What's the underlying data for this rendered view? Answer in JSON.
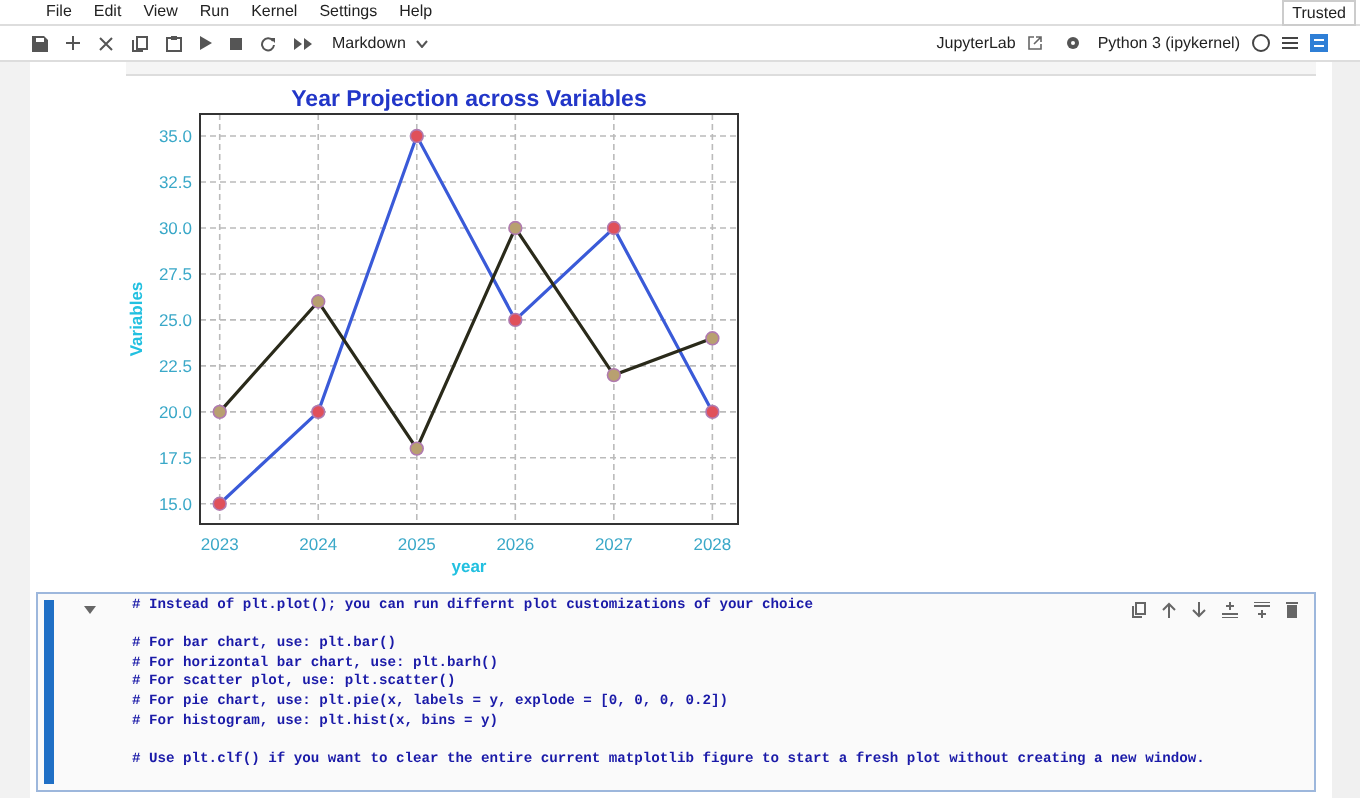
{
  "menu": [
    "File",
    "Edit",
    "View",
    "Run",
    "Kernel",
    "Settings",
    "Help"
  ],
  "trusted": "Trusted",
  "toolbar": {
    "cell_type": "Markdown",
    "jupyterlab": "JupyterLab",
    "kernel": "Python 3 (ipykernel)"
  },
  "output": {
    "chart_data": {
      "type": "line",
      "title": "Year Projection across Variables",
      "xlabel": "year",
      "ylabel": "Variables",
      "x": [
        2023,
        2024,
        2025,
        2026,
        2027,
        2028
      ],
      "series": [
        {
          "color": "#3a5ad8",
          "marker": "o",
          "values": [
            15,
            20,
            35,
            25,
            30,
            20
          ]
        },
        {
          "color": "#2a2a1a",
          "marker": "o",
          "values": [
            20,
            26,
            18,
            30,
            22,
            24
          ]
        }
      ],
      "grid": true,
      "xlim": [
        2022.8,
        2028.26
      ],
      "ylim": [
        13.9,
        36.2
      ],
      "xticks": [
        2023,
        2024,
        2025,
        2026,
        2027,
        2028
      ],
      "yticks": [
        {
          "value": 15,
          "label": "15.0"
        },
        {
          "value": 17.5,
          "label": "17.5"
        },
        {
          "value": 20,
          "label": "20.0"
        },
        {
          "value": 22.5,
          "label": "22.5"
        },
        {
          "value": 25,
          "label": "25.0"
        },
        {
          "value": 27.5,
          "label": "27.5"
        },
        {
          "value": 30,
          "label": "30.0"
        },
        {
          "value": 32.5,
          "label": "32.5"
        },
        {
          "value": 35,
          "label": "35.0"
        }
      ]
    }
  },
  "cell": {
    "blocks": [
      [
        "# Instead of plt.plot(); you can run differnt plot customizations of your choice"
      ],
      [
        "# For bar chart, use: plt.bar()",
        "# For horizontal bar chart, use: plt.barh()",
        "# For scatter plot, use: plt.scatter()",
        "# For pie chart, use: plt.pie(x, labels = y, explode = [0, 0, 0, 0.2])",
        "# For histogram, use: plt.hist(x, bins = y)"
      ],
      [
        "# Use plt.clf() if you want to clear the entire current matplotlib figure to start a fresh plot without creating a new window."
      ]
    ]
  }
}
